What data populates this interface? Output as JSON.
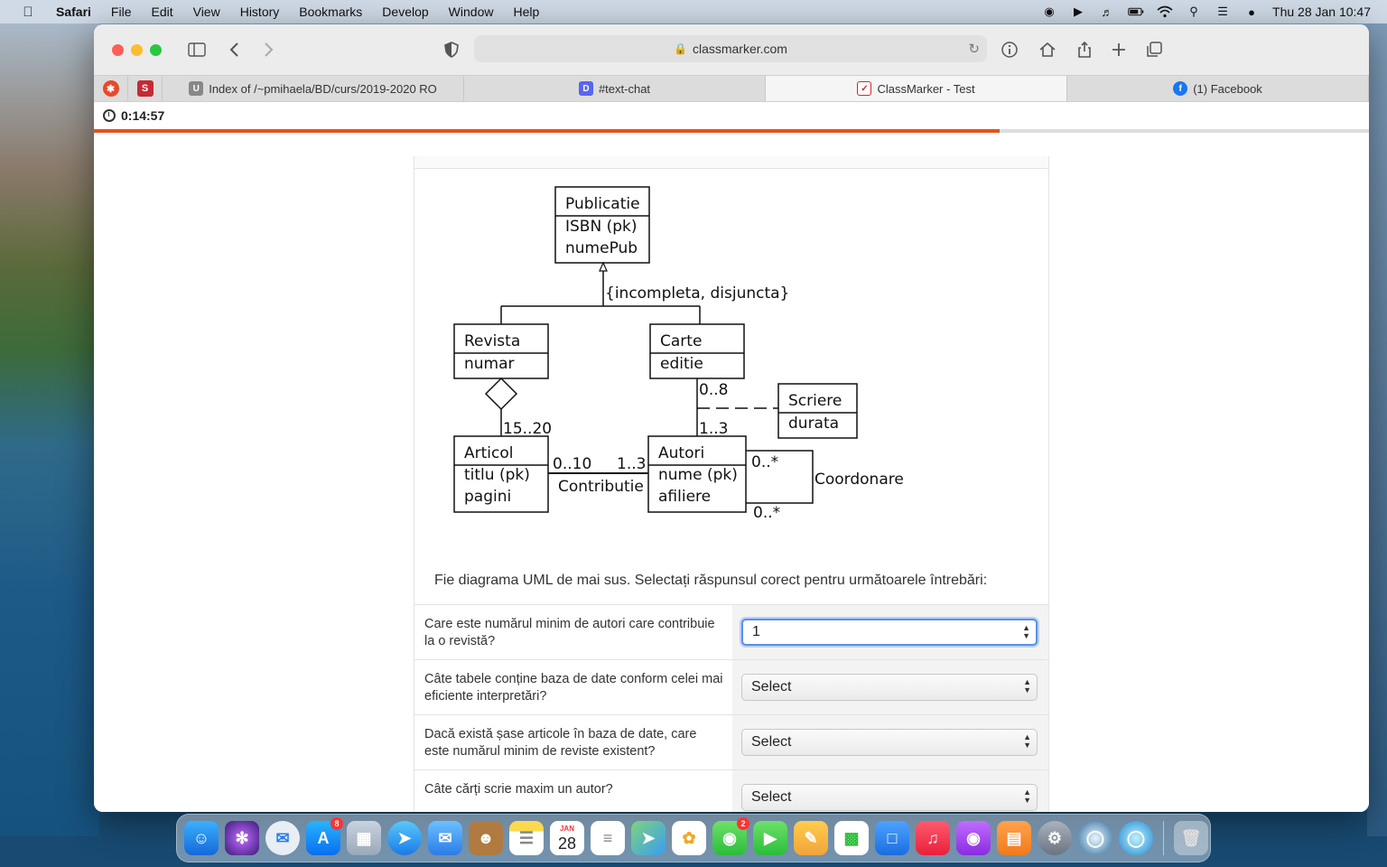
{
  "menubar": {
    "app": "Safari",
    "items": [
      "File",
      "Edit",
      "View",
      "History",
      "Bookmarks",
      "Develop",
      "Window",
      "Help"
    ],
    "datetime": "Thu 28 Jan  10:47"
  },
  "browser": {
    "url": "classmarker.com",
    "tabs": [
      {
        "label": "Index of /~pmihaela/BD/curs/2019-2020 RO",
        "fav": "U"
      },
      {
        "label": "#text-chat",
        "fav": "D"
      },
      {
        "label": "ClassMarker - Test",
        "fav": "✓"
      },
      {
        "label": "(1) Facebook",
        "fav": "f"
      }
    ],
    "active_tab": 2
  },
  "quiz": {
    "timer": "0:14:57",
    "progress": 0.71,
    "instruction": "Fie diagrama UML de mai sus. Selectați răspunsul corect pentru următoarele întrebări:",
    "questions": [
      {
        "text": "Care este numărul minim de autori care contribuie la o revistă?",
        "answer": "1"
      },
      {
        "text": "Câte tabele conține baza de date conform celei mai eficiente interpretări?",
        "answer": "Select"
      },
      {
        "text": "Dacă există șase articole în baza de date, care este numărul minim de reviste existent?",
        "answer": "Select"
      },
      {
        "text": "Câte cărți scrie maxim un autor?",
        "answer": "Select"
      }
    ]
  },
  "diagram": {
    "publicatie": [
      "Publicatie",
      "ISBN (pk)",
      "numePub"
    ],
    "constraint": "{incompleta, disjuncta}",
    "revista": [
      "Revista",
      "numar"
    ],
    "carte": [
      "Carte",
      "editie"
    ],
    "scriere": [
      "Scriere",
      "durata"
    ],
    "articol": [
      "Articol",
      "titlu (pk)",
      "pagini"
    ],
    "autori": [
      "Autori",
      "nume (pk)",
      "afiliere"
    ],
    "mult_revista_articol": "15..20",
    "mult_carte": "0..8",
    "mult_autori_carte": "1..3",
    "mult_articol": "0..10",
    "mult_autori_articol": "1..3",
    "assoc_contributie": "Contributie",
    "mult_coord_top": "0..*",
    "mult_coord_bottom": "0..*",
    "assoc_coordonare": "Coordonare"
  },
  "dock": {
    "badges": {
      "appstore": "8",
      "messages": "2"
    },
    "calendar_month": "JAN",
    "calendar_day": "28"
  }
}
